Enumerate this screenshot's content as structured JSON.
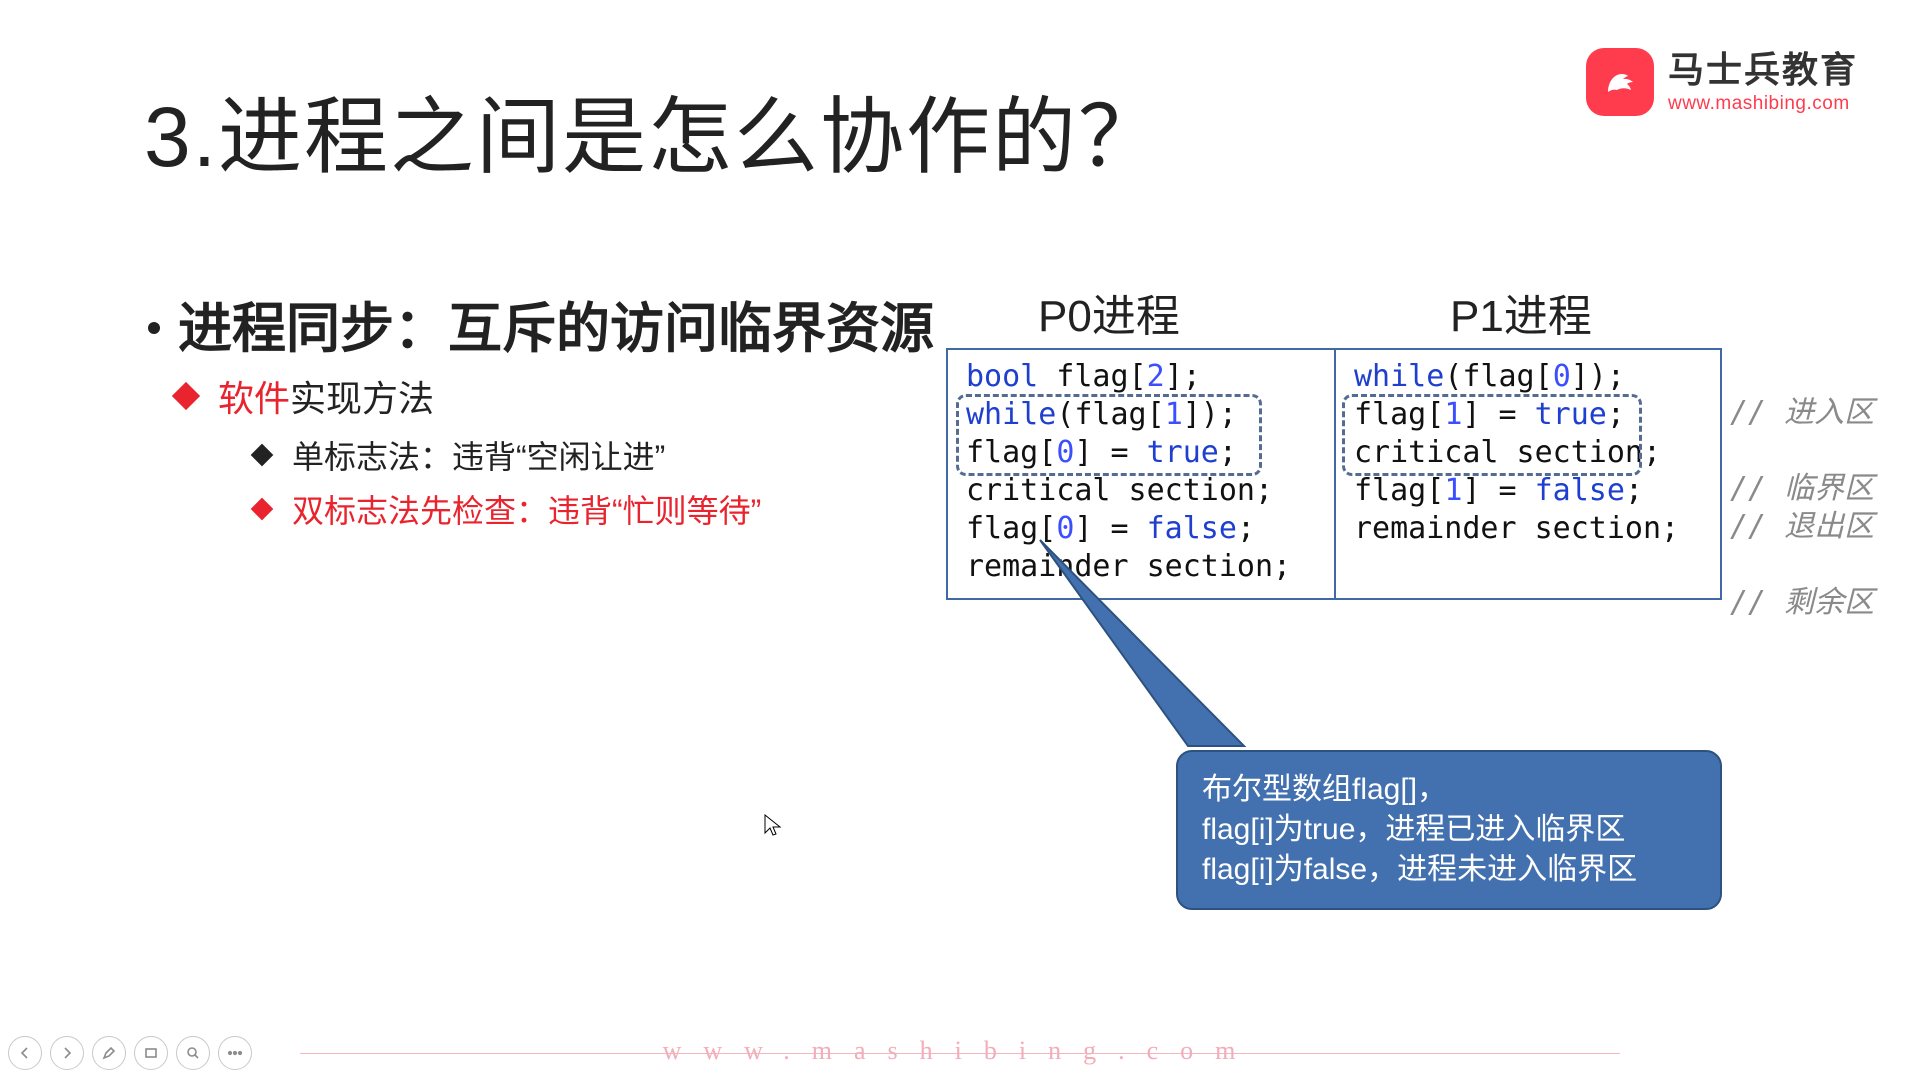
{
  "logo": {
    "name": "马士兵教育",
    "url": "www.mashibing.com"
  },
  "title": "3.进程之间是怎么协作的？",
  "subtitle": "进程同步：互斥的访问临界资源",
  "bullet1_red": "软件",
  "bullet1_rest": "实现方法",
  "bullet2": "单标志法：违背“空闲让进”",
  "bullet3": "双标志法先检查：违背“忙则等待”",
  "proc0": "P0进程",
  "proc1": "P1进程",
  "code0": {
    "l1a": "bool",
    "l1b": " flag[",
    "l1c": "2",
    "l1d": "];",
    "l2a": "while",
    "l2b": "(flag[",
    "l2c": "1",
    "l2d": "]);",
    "l3a": "flag[",
    "l3b": "0",
    "l3c": "] = ",
    "l3d": "true",
    "l3e": ";",
    "l4": "critical section;",
    "l5a": "flag[",
    "l5b": "0",
    "l5c": "] = ",
    "l5d": "false",
    "l5e": ";",
    "l6": "",
    "l7": "remainder section;"
  },
  "code1": {
    "l1": "",
    "l2a": "while",
    "l2b": "(flag[",
    "l2c": "0",
    "l2d": "]);",
    "l3a": "flag[",
    "l3b": "1",
    "l3c": "] = ",
    "l3d": "true",
    "l3e": ";",
    "l4": "critical section;",
    "l5a": "flag[",
    "l5b": "1",
    "l5c": "] = ",
    "l5d": "false",
    "l5e": ";",
    "l6": "",
    "l7": "remainder section;"
  },
  "comments": {
    "c1": "",
    "c2": "// 进入区",
    "c3": "",
    "c4": "// 临界区",
    "c5": "// 退出区",
    "c6": "",
    "c7": "// 剩余区"
  },
  "callout": {
    "l1": "布尔型数组flag[]，",
    "l2": "flag[i]为true，进程已进入临界区",
    "l3": "flag[i]为false，进程未进入临界区"
  },
  "footer_url": "www.mashibing.com"
}
